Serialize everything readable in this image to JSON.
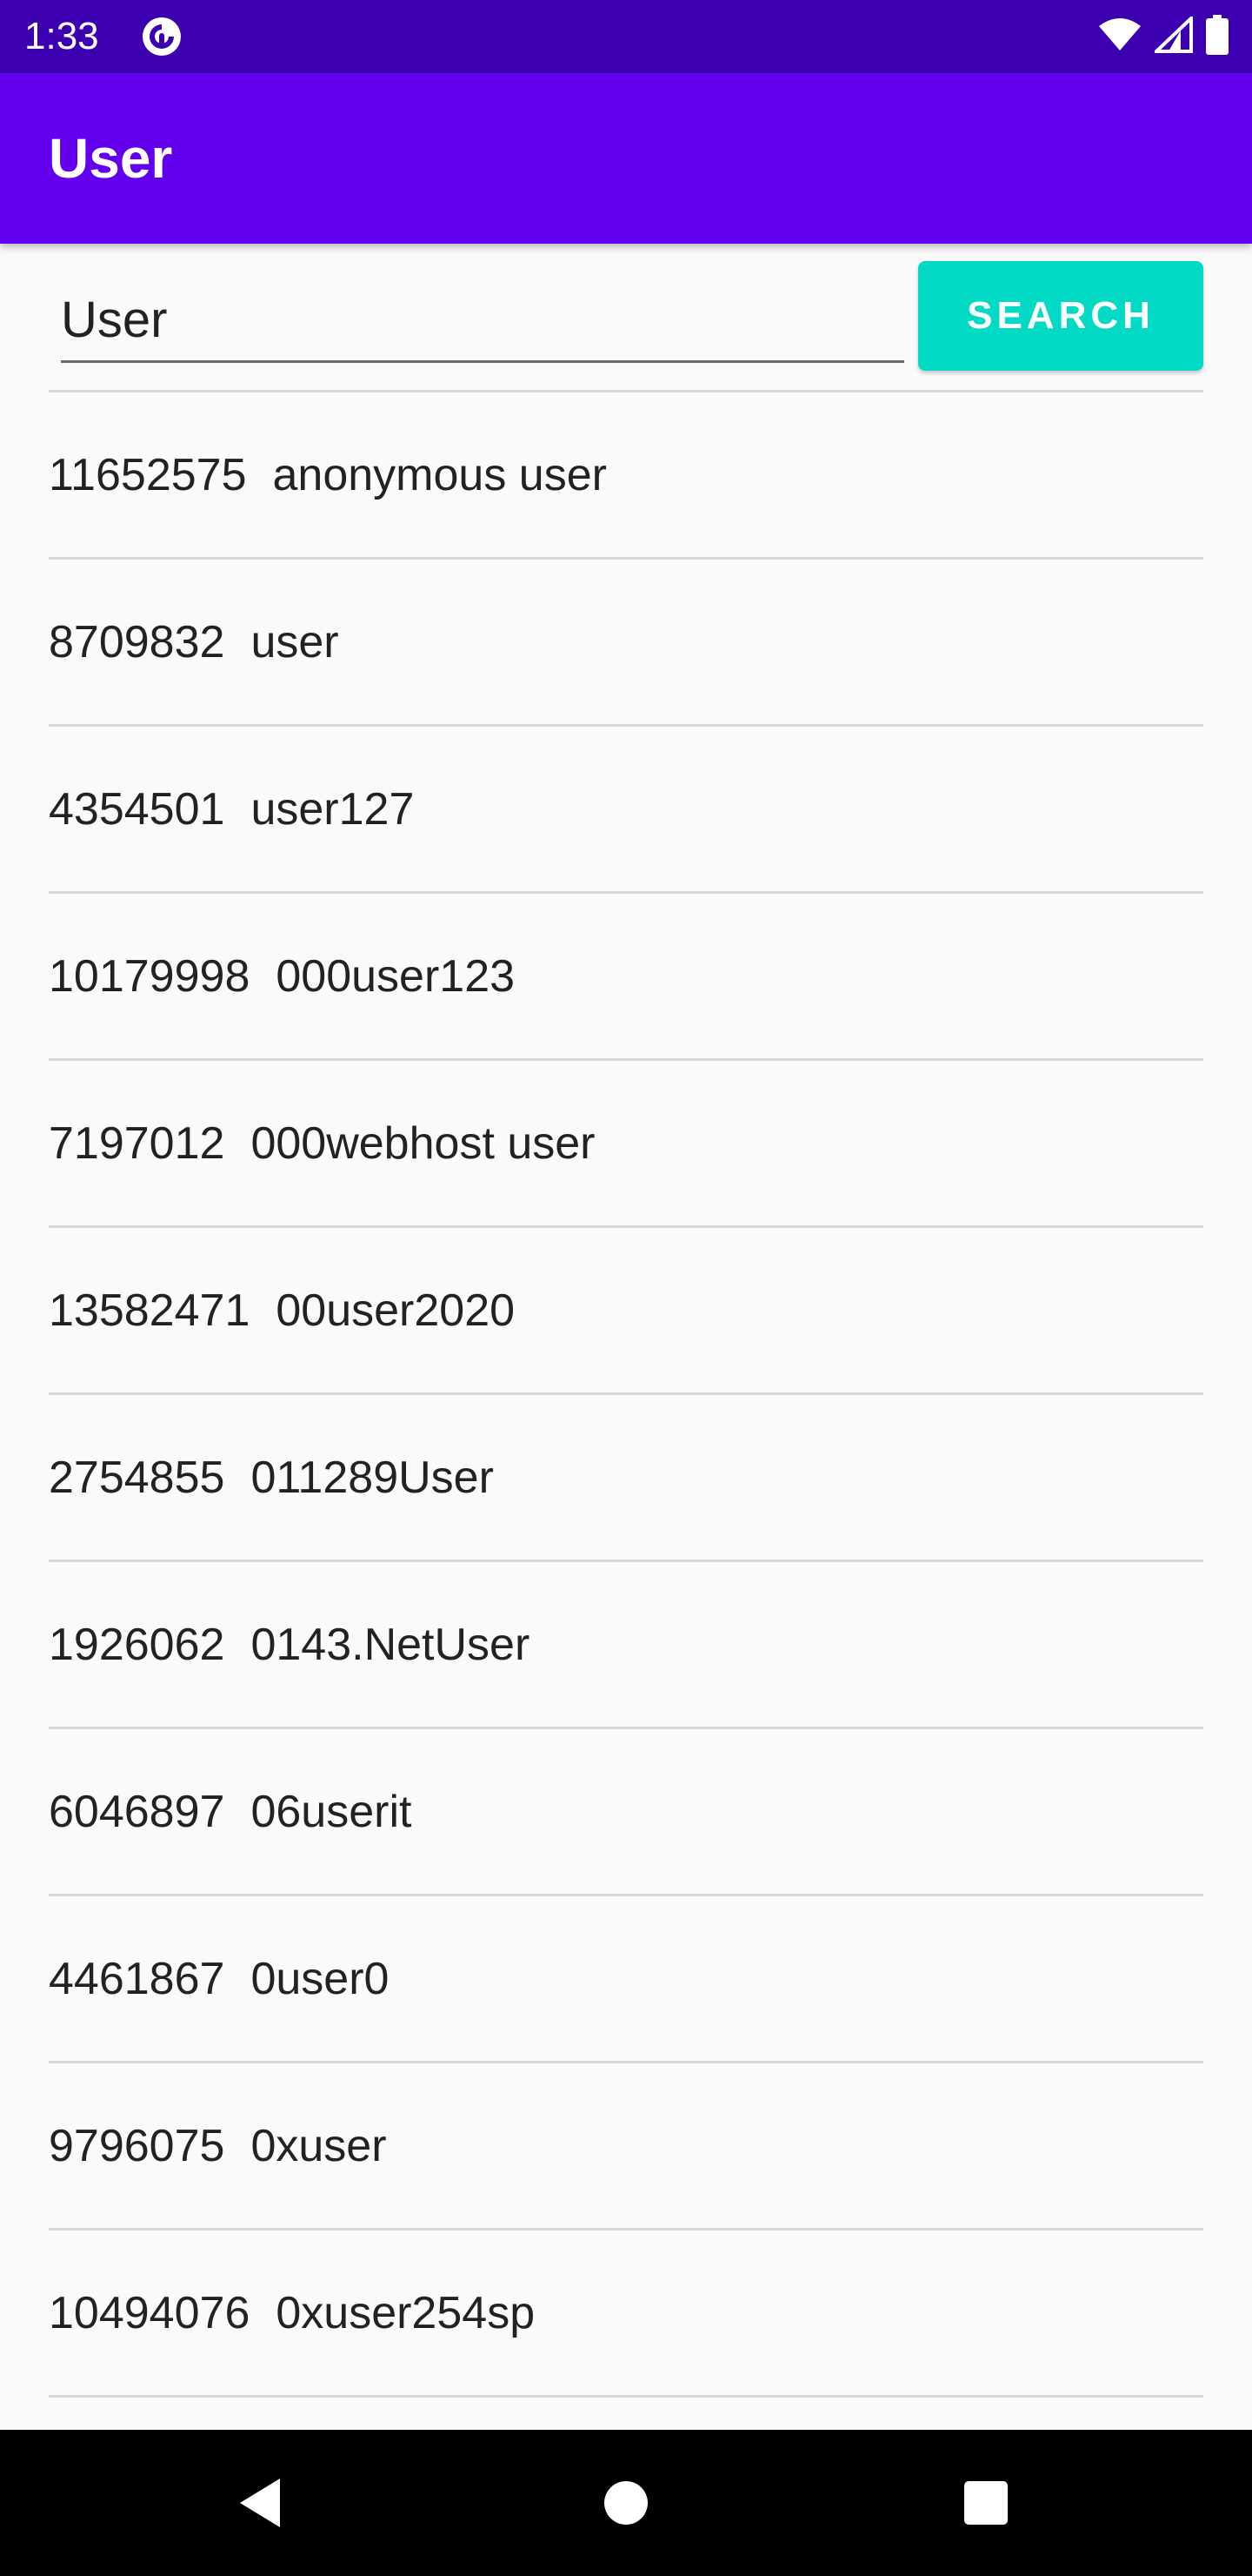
{
  "status_bar": {
    "time": "1:33",
    "app_icon": "pocket-casts-icon",
    "icons": [
      "wifi-icon",
      "signal-icon",
      "battery-icon"
    ]
  },
  "app_bar": {
    "title": "User"
  },
  "search": {
    "value": "User",
    "button_label": "SEARCH"
  },
  "results": [
    {
      "id": "11652575",
      "name": "anonymous user"
    },
    {
      "id": "8709832",
      "name": "user"
    },
    {
      "id": "4354501",
      "name": "user127"
    },
    {
      "id": "10179998",
      "name": "000user123"
    },
    {
      "id": "7197012",
      "name": "000webhost user"
    },
    {
      "id": "13582471",
      "name": "00user2020"
    },
    {
      "id": "2754855",
      "name": "011289User"
    },
    {
      "id": "1926062",
      "name": "0143.NetUser"
    },
    {
      "id": "6046897",
      "name": "06userit"
    },
    {
      "id": "4461867",
      "name": "0user0"
    },
    {
      "id": "9796075",
      "name": "0xuser"
    },
    {
      "id": "10494076",
      "name": "0xuser254sp"
    }
  ],
  "nav_bar": {
    "buttons": [
      "back-icon",
      "home-icon",
      "recents-icon"
    ]
  },
  "colors": {
    "status_bar": "#3d00b0",
    "app_bar": "#6200ee",
    "accent": "#03dac5",
    "background": "#fafafa",
    "divider": "#d8d8d8"
  }
}
